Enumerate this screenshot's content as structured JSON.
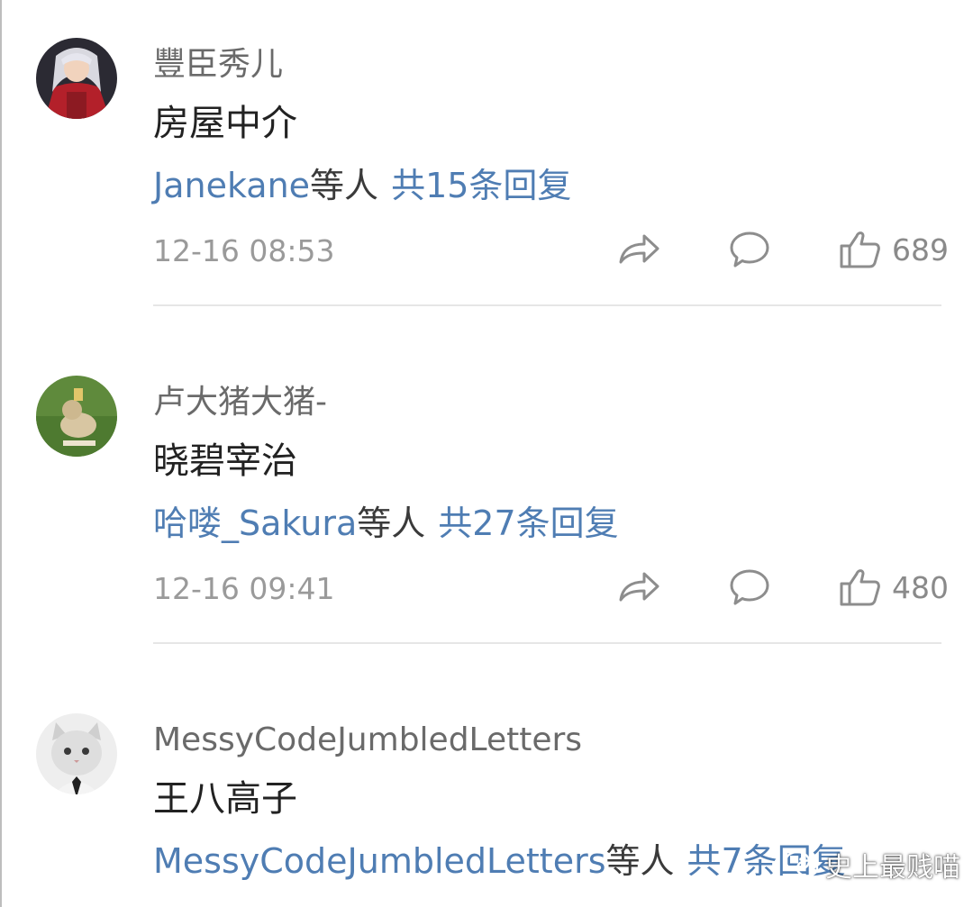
{
  "comments": [
    {
      "username": "豐臣秀儿",
      "content": "房屋中介",
      "reply_users": "Janekane",
      "reply_suffix": "等人",
      "reply_total": "共15条回复",
      "timestamp": "12-16 08:53",
      "likes": "689",
      "avatar_icon": "anime-character-avatar"
    },
    {
      "username": "卢大猪大猪-",
      "content": "晓碧宰治",
      "reply_users": "哈喽_Sakura",
      "reply_suffix": "等人",
      "reply_total": "共27条回复",
      "timestamp": "12-16 09:41",
      "likes": "480",
      "avatar_icon": "cat-on-grass-avatar"
    },
    {
      "username": "MessyCodeJumbledLetters",
      "content": "王八高子",
      "reply_users": "MessyCodeJumbledLetters",
      "reply_suffix": "等人",
      "reply_total": "共7条回复",
      "avatar_icon": "cat-with-tie-avatar"
    }
  ],
  "watermark": {
    "text": "史上最贱喵",
    "icon": "wechat-icon"
  },
  "colors": {
    "link": "#4f7db3",
    "username": "#6a6a6a",
    "content": "#222222",
    "meta": "#9a9a9a",
    "divider": "#e6e6e6"
  }
}
